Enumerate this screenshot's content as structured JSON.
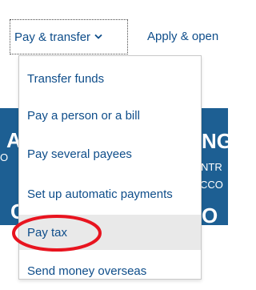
{
  "banner": {
    "fragments": {
      "a": "A",
      "ng": "NG",
      "o": "O",
      "ntr": "NTR",
      "cco": "CCO",
      "c": "C",
      "o2": "O"
    },
    "color": "#1d5f93"
  },
  "nav": {
    "pay_transfer_label": "Pay & transfer",
    "chevron_icon": "chevron-down-icon",
    "apply_label": "Apply & open"
  },
  "menu": {
    "items": [
      {
        "label": "Transfer funds"
      },
      {
        "label": "Pay a person or a bill"
      },
      {
        "label": "Pay several payees"
      },
      {
        "label": "Set up automatic payments"
      },
      {
        "label": "Pay tax",
        "highlighted": true
      },
      {
        "label": "Send money overseas"
      }
    ]
  },
  "colors": {
    "link": "#0e4d8a",
    "highlight_bg": "#e9e9e9",
    "annotation": "#e8141f"
  }
}
